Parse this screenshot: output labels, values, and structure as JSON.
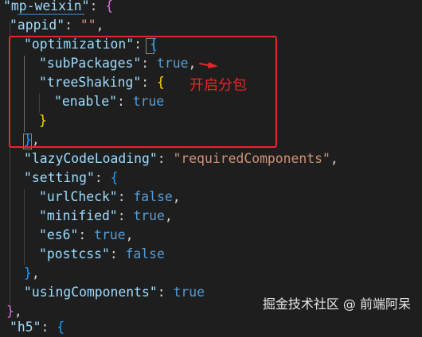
{
  "code": {
    "l1_key": "\"mp-weixin\"",
    "l2_key": "\"appid\"",
    "l2_val": "\"\"",
    "l3_key": "\"optimization\"",
    "l4_key": "\"subPackages\"",
    "l4_val": "true",
    "l5_key": "\"treeShaking\"",
    "l6_key": "\"enable\"",
    "l6_val": "true",
    "l9_key": "\"lazyCodeLoading\"",
    "l9_val": "\"requiredComponents\"",
    "l10_key": "\"setting\"",
    "l11_key": "\"urlCheck\"",
    "l11_val": "false",
    "l12_key": "\"minified\"",
    "l12_val": "true",
    "l13_key": "\"es6\"",
    "l13_val": "true",
    "l14_key": "\"postcss\"",
    "l14_val": "false",
    "l16_key": "\"usingComponents\"",
    "l16_val": "true",
    "l18_partial": "\"h5\""
  },
  "annotation": {
    "text": "开启分包",
    "color": "#e8262a"
  },
  "watermark": {
    "text": "掘金技术社区 @ 前端阿呆"
  },
  "colors": {
    "background": "#1e1e1e",
    "json_key": "#9cdcfe",
    "json_string": "#ce9178",
    "json_literal": "#569cd6",
    "bracket_level1": "#ffd700",
    "bracket_level2": "#da70d6",
    "bracket_level3": "#179fff",
    "highlight_box": "#e8262a"
  }
}
